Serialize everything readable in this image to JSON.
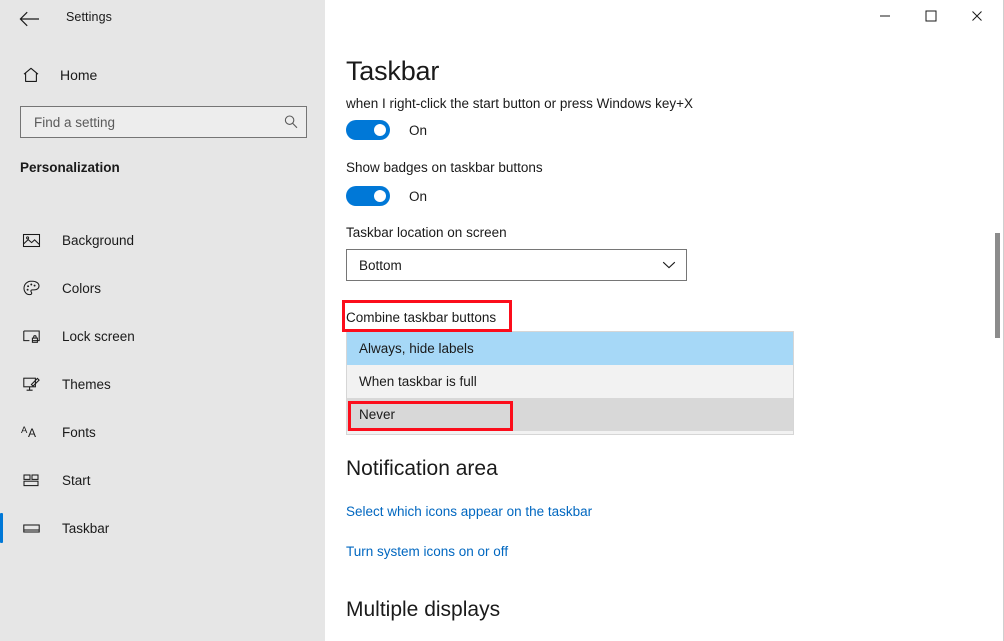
{
  "window": {
    "title": "Settings",
    "back_icon": "back-arrow-icon",
    "minimize_label": "—",
    "maximize_label": "□",
    "close_label": "✕"
  },
  "sidebar": {
    "home_label": "Home",
    "home_icon": "home-icon",
    "search": {
      "placeholder": "Find a setting",
      "value": "",
      "icon": "search-icon"
    },
    "category": "Personalization",
    "items": [
      {
        "label": "Background",
        "icon": "picture-icon",
        "selected": false
      },
      {
        "label": "Colors",
        "icon": "palette-icon",
        "selected": false
      },
      {
        "label": "Lock screen",
        "icon": "lock-screen-icon",
        "selected": false
      },
      {
        "label": "Themes",
        "icon": "brush-icon",
        "selected": false
      },
      {
        "label": "Fonts",
        "icon": "fonts-icon",
        "selected": false
      },
      {
        "label": "Start",
        "icon": "start-tiles-icon",
        "selected": false
      },
      {
        "label": "Taskbar",
        "icon": "taskbar-icon",
        "selected": true
      }
    ]
  },
  "main": {
    "page_title": "Taskbar",
    "setting_rightclick": {
      "description": "when I right-click the start button or press Windows key+X",
      "toggle_state": "On"
    },
    "setting_badges": {
      "description": "Show badges on taskbar buttons",
      "toggle_state": "On"
    },
    "taskbar_location": {
      "label": "Taskbar location on screen",
      "value": "Bottom",
      "chevron_icon": "chevron-down-icon"
    },
    "combine_buttons": {
      "label": "Combine taskbar buttons",
      "options": [
        {
          "label": "Always, hide labels",
          "state": "selected"
        },
        {
          "label": "When taskbar is full",
          "state": "normal"
        },
        {
          "label": "Never",
          "state": "hover"
        }
      ]
    },
    "notification_area": {
      "heading": "Notification area",
      "links": [
        "Select which icons appear on the taskbar",
        "Turn system icons on or off"
      ]
    },
    "multiple_displays": {
      "heading": "Multiple displays"
    }
  },
  "annotations": {
    "color": "#fc0d1b",
    "boxes": [
      {
        "target": "combine-taskbar-buttons-label"
      },
      {
        "target": "listbox-option-never"
      }
    ]
  }
}
